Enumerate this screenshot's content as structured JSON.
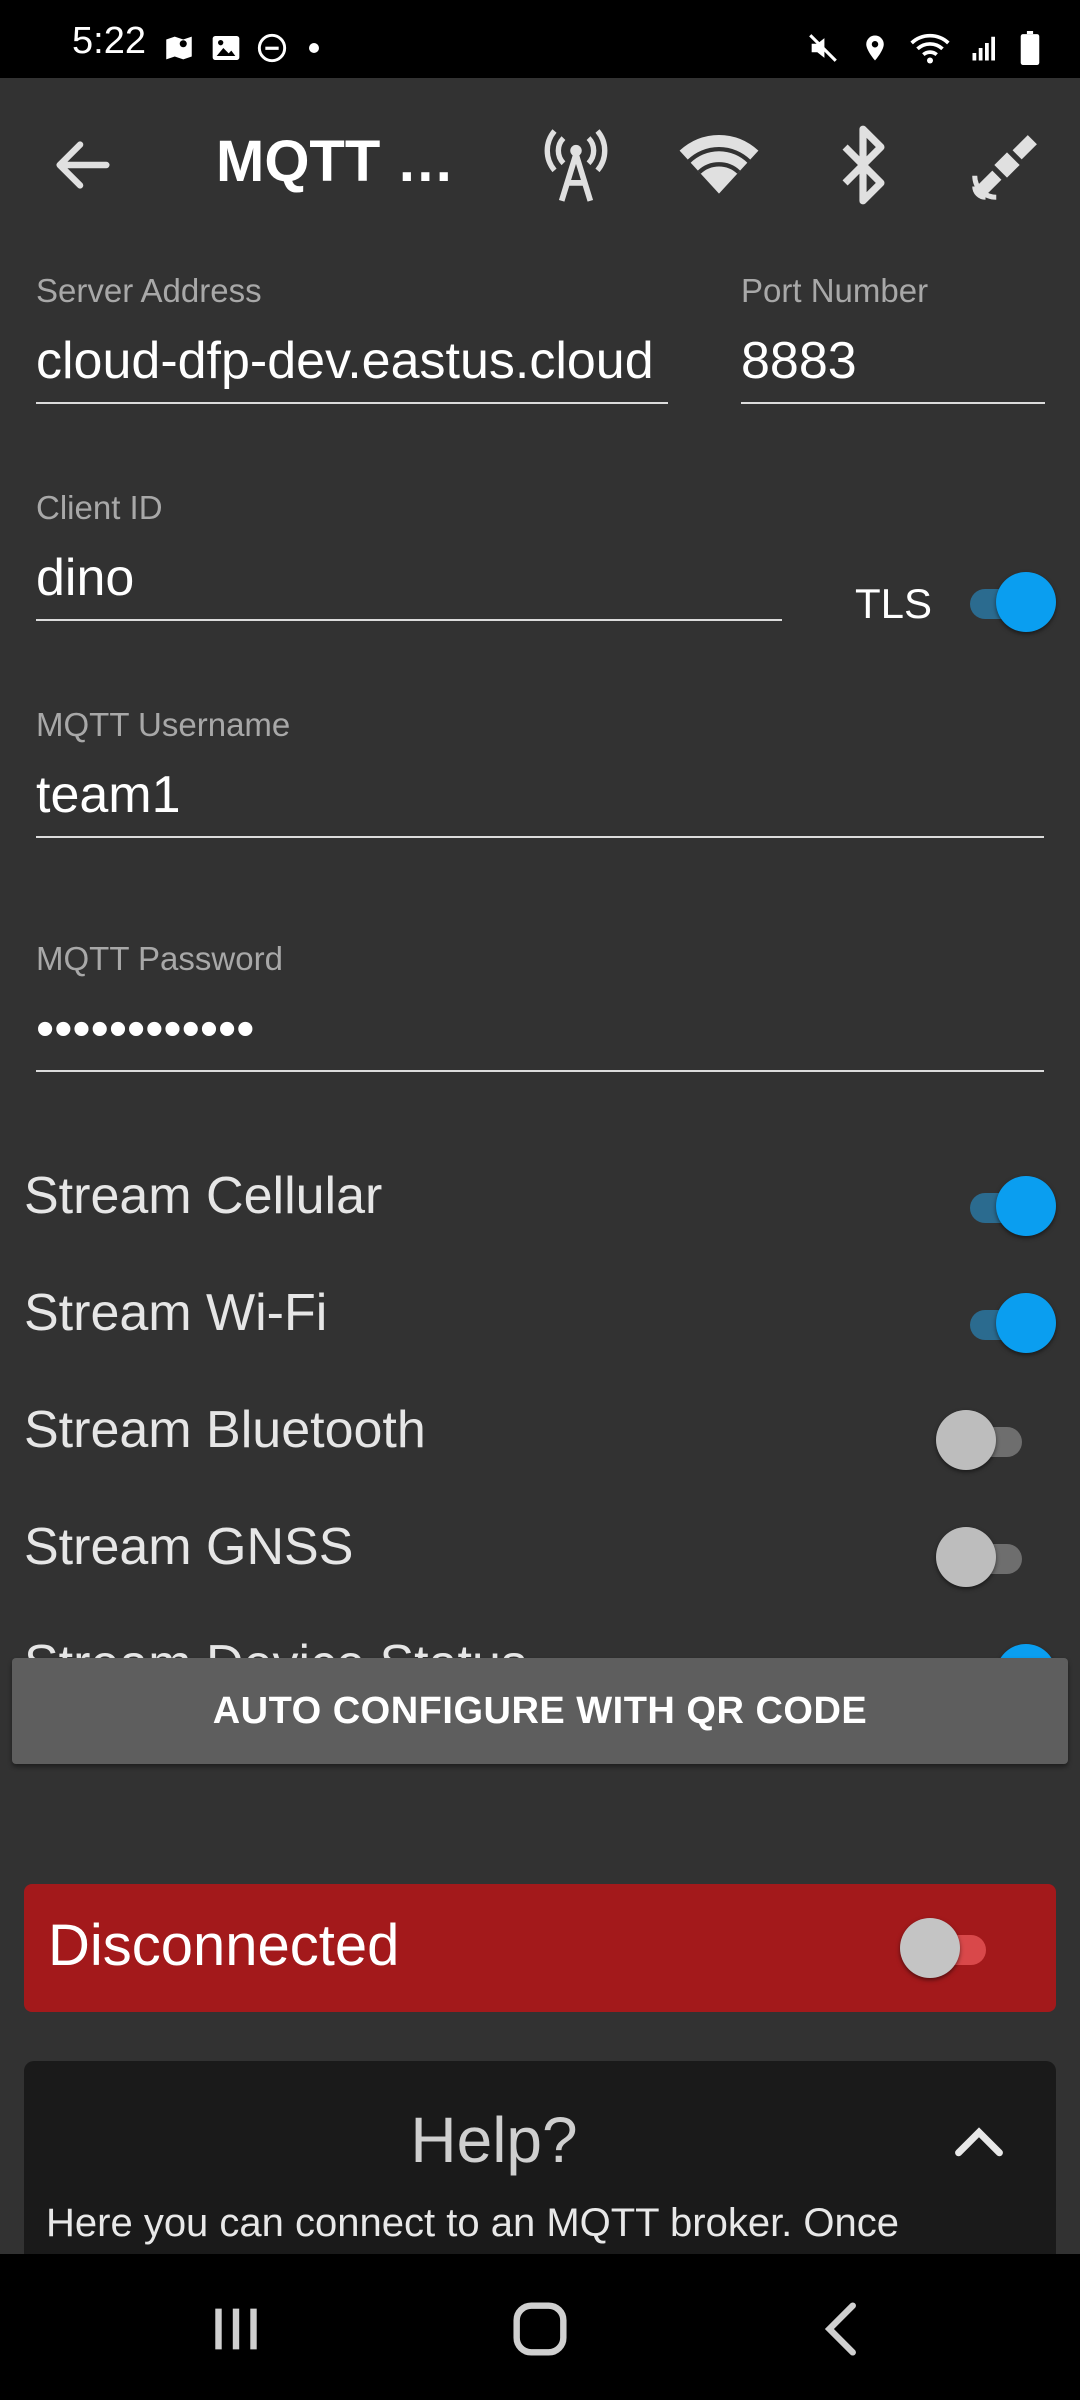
{
  "status_bar": {
    "time": "5:22",
    "left_icons": [
      "maps-icon",
      "gallery-icon",
      "dnd-icon",
      "dot-icon"
    ],
    "right_icons": [
      "mute-icon",
      "location-icon",
      "wifi-icon",
      "signal-icon",
      "battery-icon"
    ]
  },
  "toolbar": {
    "title": "MQTT B...",
    "icons": [
      "cell-tower-icon",
      "wifi-icon",
      "bluetooth-icon",
      "satellite-icon"
    ]
  },
  "form": {
    "server_address": {
      "label": "Server Address",
      "value": "cloud-dfp-dev.eastus.cloud"
    },
    "port_number": {
      "label": "Port Number",
      "value": "8883"
    },
    "client_id": {
      "label": "Client ID",
      "value": "dino"
    },
    "tls": {
      "label": "TLS",
      "enabled": true
    },
    "username": {
      "label": "MQTT Username",
      "value": "team1"
    },
    "password": {
      "label": "MQTT Password",
      "value": "••••••••••••"
    }
  },
  "streams": [
    {
      "label": "Stream Cellular",
      "enabled": true
    },
    {
      "label": "Stream Wi-Fi",
      "enabled": true
    },
    {
      "label": "Stream Bluetooth",
      "enabled": false
    },
    {
      "label": "Stream GNSS",
      "enabled": false
    },
    {
      "label": "Stream Device Status",
      "enabled": true
    }
  ],
  "qr_button": {
    "label": "AUTO CONFIGURE WITH QR CODE"
  },
  "connection": {
    "status": "Disconnected",
    "enabled": false
  },
  "help": {
    "title": "Help?",
    "body": "Here you can connect to an MQTT broker. Once"
  },
  "nav_bar": {
    "buttons": [
      "recents-icon",
      "home-icon",
      "back-icon"
    ]
  },
  "colors": {
    "background": "#323232",
    "accent": "#0a9ef0",
    "disconnected": "#a3191b",
    "button": "#5e5e5e"
  }
}
